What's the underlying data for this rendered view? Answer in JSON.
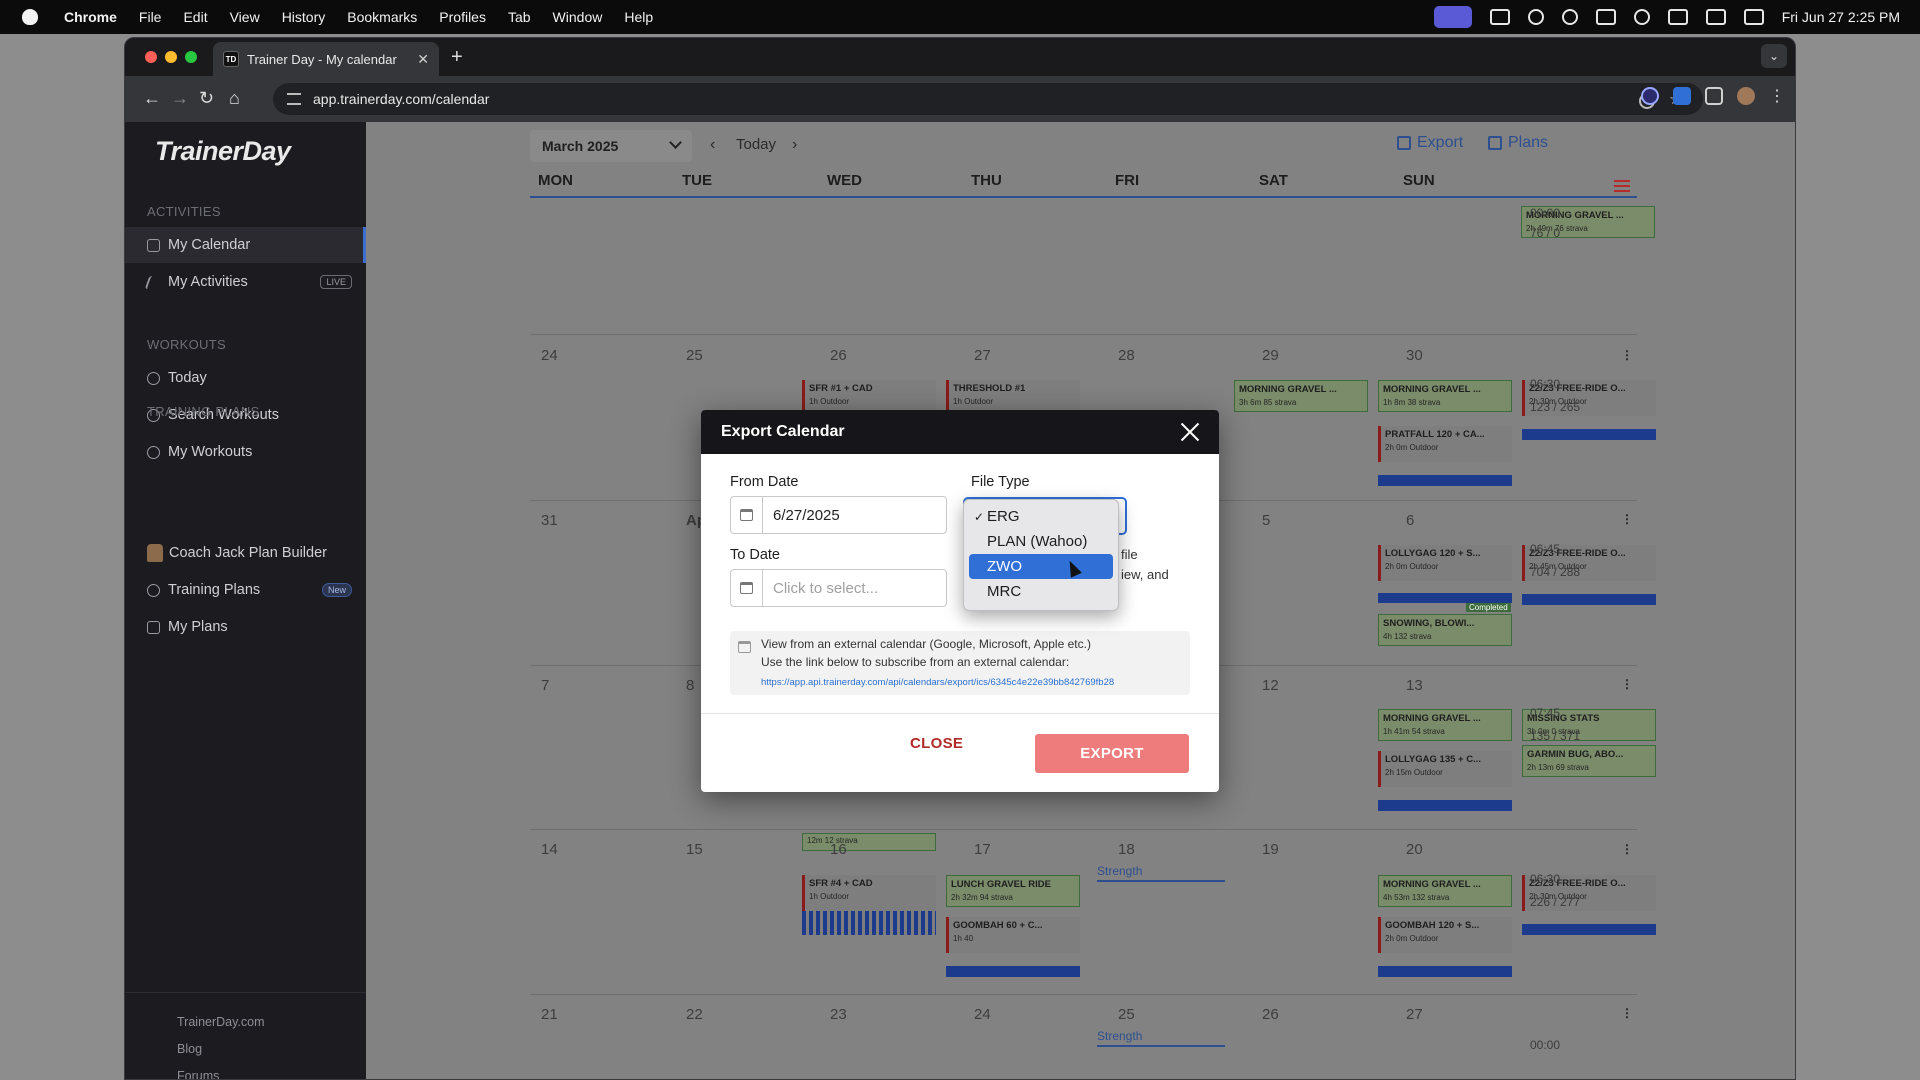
{
  "menubar": {
    "app": "Chrome",
    "items": [
      "File",
      "Edit",
      "View",
      "History",
      "Bookmarks",
      "Profiles",
      "Tab",
      "Window",
      "Help"
    ],
    "clock": "Fri Jun 27  2:25 PM"
  },
  "browser": {
    "tab_title": "Trainer Day - My calendar",
    "favicon_text": "TD",
    "url": "app.trainerday.com/calendar"
  },
  "sidebar": {
    "logo": "TrainerDay",
    "sections": {
      "activities": "ACTIVITIES",
      "workouts": "WORKOUTS",
      "plans": "TRAINING PLANS"
    },
    "items": [
      {
        "label": "My Calendar",
        "icon": "calendar-icon"
      },
      {
        "label": "My Activities",
        "icon": "activity-icon",
        "badge": "LIVE"
      },
      {
        "label": "Today",
        "icon": "clock-icon"
      },
      {
        "label": "Search Workouts",
        "icon": "search-icon"
      },
      {
        "label": "My Workouts",
        "icon": "bike-icon"
      },
      {
        "label": "Coach Jack Plan Builder",
        "icon": "coach-icon"
      },
      {
        "label": "Training Plans",
        "icon": "plans-icon",
        "badge": "New"
      },
      {
        "label": "My Plans",
        "icon": "book-icon"
      }
    ],
    "footer": [
      "TrainerDay.com",
      "Blog",
      "Forums"
    ]
  },
  "calendar": {
    "month": "March 2025",
    "today": "Today",
    "export": "Export",
    "plans": "Plans",
    "days": [
      "MON",
      "TUE",
      "WED",
      "THU",
      "FRI",
      "SAT",
      "SUN"
    ],
    "weeks": [
      {
        "nums": [
          "24",
          "25",
          "26",
          "27",
          "28",
          "29",
          "30"
        ],
        "time": "06:30",
        "load": "123 / 265"
      },
      {
        "nums": [
          "31",
          "Ap",
          "",
          "",
          "",
          "5",
          "6"
        ],
        "time": "06:45",
        "load": "704 / 288"
      },
      {
        "nums": [
          "7",
          "8",
          "",
          "",
          "",
          "12",
          "13"
        ],
        "time": "07:45",
        "load": "135 / 371"
      },
      {
        "nums": [
          "14",
          "15",
          "16",
          "17",
          "18",
          "19",
          "20"
        ],
        "time": "06:30",
        "load": "226 / 277"
      },
      {
        "nums": [
          "21",
          "22",
          "23",
          "24",
          "25",
          "26",
          "27"
        ],
        "time": "00:00",
        "load": ""
      }
    ],
    "top_row": {
      "card": "MORNING GRAVEL ...",
      "meta": "2h 49m  76  strava",
      "time": "00:00",
      "load": "76 / 0"
    },
    "cards": {
      "w1_tue": {
        "title": "SFR #1 + CAD",
        "meta": "1h   Outdoor"
      },
      "w1_wed": {
        "title": "THRESHOLD #1",
        "meta": "1h   Outdoor"
      },
      "w1_fri": {
        "title": "MORNING GRAVEL ...",
        "meta": "3h 6m  85  strava"
      },
      "w1_sat1": {
        "title": "MORNING GRAVEL ...",
        "meta": "1h 8m  38  strava"
      },
      "w1_sat2": {
        "title": "PRATFALL 120 + CA...",
        "meta": "2h 0m   Outdoor"
      },
      "w1_sun": {
        "title": "Z2/Z3 FREE-RIDE O...",
        "meta": "2h 30m  Outdoor"
      },
      "w2_sat1": {
        "title": "LOLLYGAG 120 + S...",
        "meta": "2h 0m   Outdoor"
      },
      "w2_sat_status": "Completed",
      "w2_sat2": {
        "title": "SNOWING, BLOWI...",
        "meta": "4h   132  strava"
      },
      "w2_sun": {
        "title": "Z2/Z3 FREE-RIDE O...",
        "meta": "2h 45m  Outdoor"
      },
      "w3_sat1": {
        "title": "MORNING GRAVEL ...",
        "meta": "1h 41m  54  strava"
      },
      "w3_sat2": {
        "title": "LOLLYGAG 135 + C...",
        "meta": "2h 15m  Outdoor"
      },
      "w3_sun1": {
        "title": "MISSING STATS",
        "meta": "3h 0m  0  strava"
      },
      "w3_sun2": {
        "title": "GARMIN BUG, ABO...",
        "meta": "2h 13m  69  strava"
      },
      "w3_tue_meta": "12m  12  strava",
      "w4_tue": {
        "title": "SFR #4 + CAD",
        "meta": "1h   Outdoor"
      },
      "w4_wed1": {
        "title": "LUNCH GRAVEL RIDE",
        "meta": "2h 32m  94  strava"
      },
      "w4_wed2": {
        "title": "GOOMBAH 60 + C...",
        "meta": "1h   40"
      },
      "w4_sat1": {
        "title": "MORNING GRAVEL ...",
        "meta": "4h 53m  132  strava"
      },
      "w4_sat2": {
        "title": "GOOMBAH 120 + S...",
        "meta": "2h 0m   Outdoor"
      },
      "w4_sun": {
        "title": "Z2/Z3 FREE-RIDE O...",
        "meta": "2h 30m  Outdoor"
      },
      "strength": "Strength"
    }
  },
  "modal": {
    "title": "Export Calendar",
    "from_label": "From Date",
    "from_value": "6/27/2025",
    "to_label": "To Date",
    "to_placeholder": "Click to select...",
    "filetype_label": "File Type",
    "hint_l1": "file",
    "hint_l2": "iew, and",
    "info_l1": "View from an external calendar (Google, Microsoft, Apple etc.)",
    "info_l2": "Use the link below to subscribe from an external calendar:",
    "info_link": "https://app.api.trainerday.com/api/calendars/export/ics/6345c4e22e39bb842769fb28",
    "close": "CLOSE",
    "export": "EXPORT"
  },
  "dropdown": {
    "options": [
      "ERG",
      "PLAN (Wahoo)",
      "ZWO",
      "MRC"
    ],
    "checked": "ERG",
    "highlighted": "ZWO"
  }
}
